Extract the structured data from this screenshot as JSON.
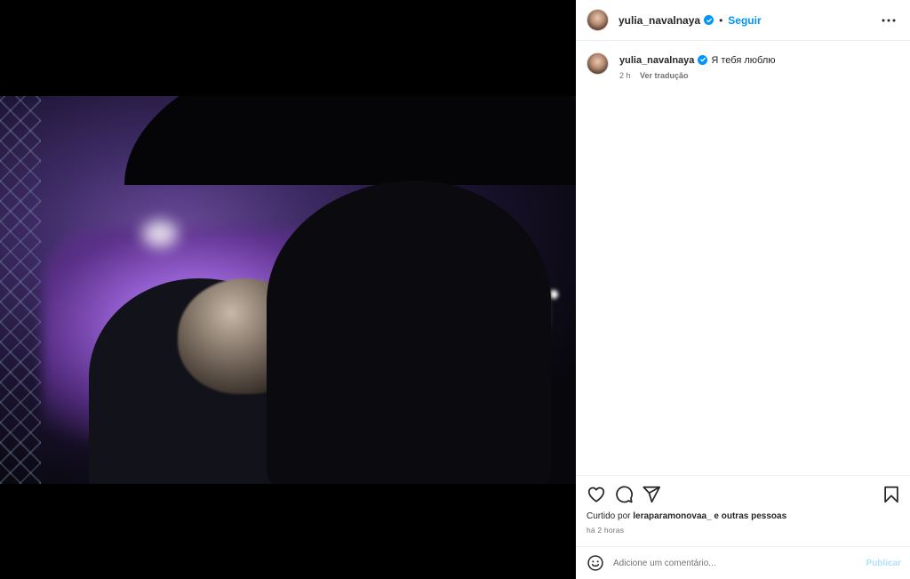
{
  "post": {
    "username": "yulia_navalnaya",
    "follow_label": "Seguir",
    "separator": "•",
    "caption_text": "Я тебя люблю",
    "caption_time": "2 h",
    "translate_label": "Ver tradução",
    "liked_prefix": "Curtido por",
    "liked_user": "leraparamonovaa_",
    "liked_suffix": "e outras pessoas",
    "time_ago": "há 2 horas"
  },
  "comment": {
    "placeholder": "Adicione um comentário...",
    "publish_label": "Publicar"
  },
  "icons": {
    "verified": "verified-badge-icon",
    "more": "more-options-icon",
    "like": "heart-icon",
    "comment": "comment-icon",
    "share": "send-icon",
    "save": "bookmark-icon",
    "emoji": "emoji-icon"
  },
  "colors": {
    "accent": "#0095f6",
    "publish_disabled": "#b2dffc",
    "muted": "#737373"
  }
}
